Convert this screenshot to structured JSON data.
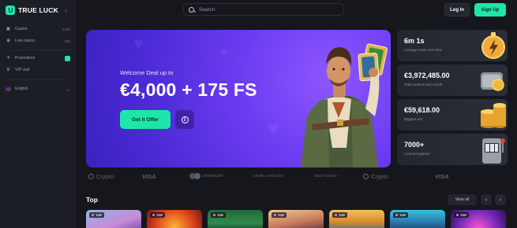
{
  "brand": {
    "name": "TRUE LUCK"
  },
  "sidebar": {
    "items": [
      {
        "label": "Casino",
        "count": "4490",
        "icon": "casino-icon"
      },
      {
        "label": "Live casino",
        "count": "325",
        "icon": "live-casino-icon"
      },
      {
        "label": "Promotions",
        "icon": "promotions-icon"
      },
      {
        "label": "VIP club",
        "icon": "vip-icon"
      },
      {
        "label": "English",
        "icon": "uk-flag-icon"
      }
    ]
  },
  "header": {
    "search_placeholder": "Search",
    "login_label": "Log In",
    "signup_label": "Sign Up"
  },
  "hero": {
    "subtitle": "Welcome Deal up to",
    "headline": "€4,000 + 175 FS",
    "cta_label": "Get It Offer"
  },
  "stats": [
    {
      "value": "6m 1s",
      "label": "Average Cash Out Time",
      "icon": "lightning-icon"
    },
    {
      "value": "€3,972,485.00",
      "label": "Total cashout last month",
      "icon": "wallet-icon"
    },
    {
      "value": "€59,618.00",
      "label": "Biggest win",
      "icon": "coins-icon"
    },
    {
      "value": "7000+",
      "label": "Licensed games",
      "icon": "slot-machine-icon"
    }
  ],
  "payments": [
    {
      "label": "Crypto"
    },
    {
      "label": "VISA"
    },
    {
      "label": "mastercard"
    },
    {
      "label": "Identity Verification"
    },
    {
      "label": "Bank Transfer"
    },
    {
      "label": "Crypto"
    },
    {
      "label": "VISA"
    }
  ],
  "top_section": {
    "title": "Top",
    "view_all_label": "View all",
    "tag_label": "TOP"
  },
  "colors": {
    "accent": "#1ee6a8",
    "background": "#15171c",
    "sidebar": "#1b1e24",
    "hero_purple": "#6b3cf0"
  }
}
